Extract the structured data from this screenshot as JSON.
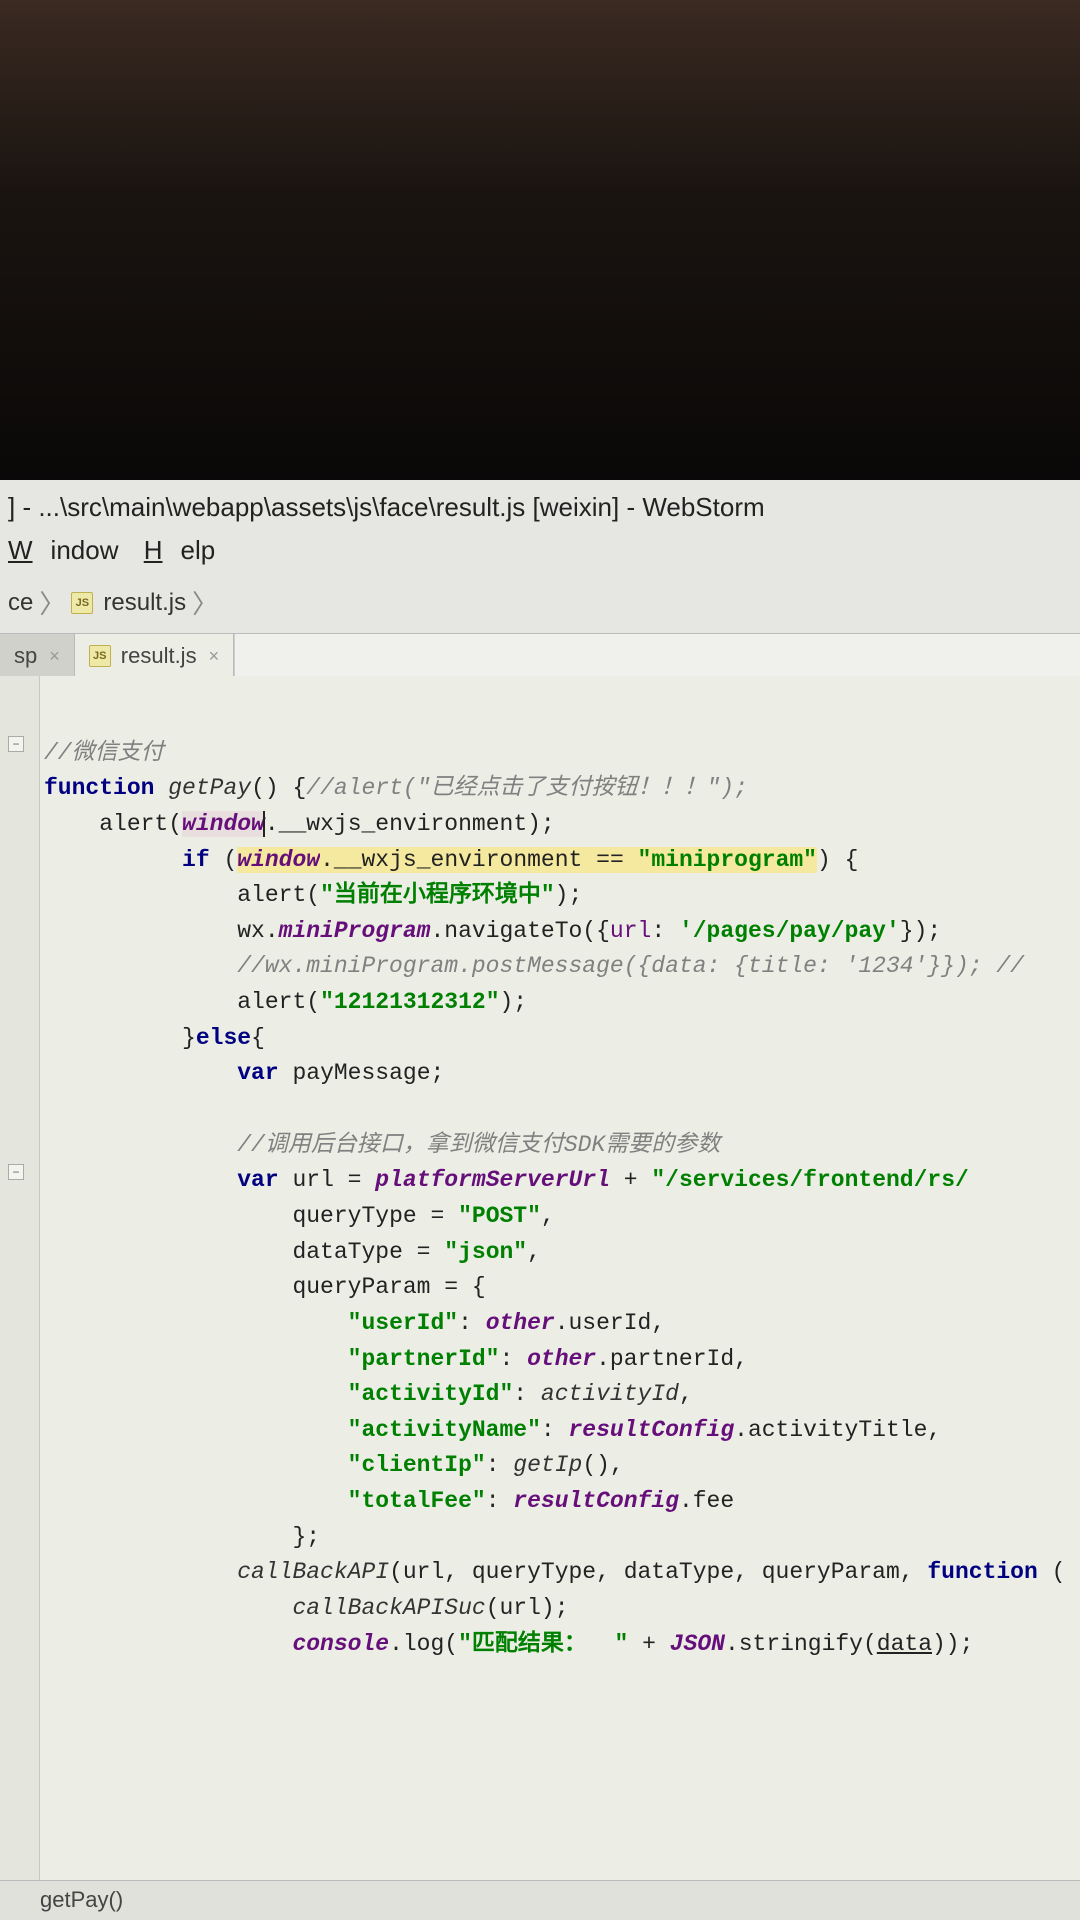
{
  "titlebar": "] - ...\\src\\main\\webapp\\assets\\js\\face\\result.js [weixin] - WebStorm",
  "menu": {
    "window": "Window",
    "help": "Help"
  },
  "breadcrumb": {
    "parent": "ce",
    "file": "result.js"
  },
  "tabs": {
    "left": "sp",
    "active": "result.js"
  },
  "code": {
    "c1": "//微信支付",
    "c2a": "function",
    "c2b": "getPay",
    "c2c": "() {",
    "c2d": "//alert(\"已经点击了支付按钮！！！\");",
    "c3a": "alert(",
    "c3b": "window",
    "c3c": ".__wxjs_environment);",
    "c4a": "if",
    "c4b": "(",
    "c4c": "window",
    "c4d": ".__wxjs_environment == ",
    "c4e": "\"miniprogram\"",
    "c4f": ") {",
    "c5a": "alert(",
    "c5b": "\"当前在小程序环境中\"",
    "c5c": ");",
    "c6a": "wx.",
    "c6b": "miniProgram",
    "c6c": ".navigateTo({",
    "c6d": "url",
    "c6e": ": ",
    "c6f": "'/pages/pay/pay'",
    "c6g": "});",
    "c7": "//wx.miniProgram.postMessage({data: {title: '1234'}}); //",
    "c8a": "alert(",
    "c8b": "\"12121312312\"",
    "c8c": ");",
    "c9a": "}",
    "c9b": "else",
    "c9c": "{",
    "c10a": "var",
    "c10b": "payMessage;",
    "c12": "//调用后台接口，拿到微信支付SDK需要的参数",
    "c13a": "var",
    "c13b": "url = ",
    "c13c": "platformServerUrl",
    "c13d": " + ",
    "c13e": "\"/services/frontend/rs/",
    "c14a": "queryType = ",
    "c14b": "\"POST\"",
    "c14c": ",",
    "c15a": "dataType = ",
    "c15b": "\"json\"",
    "c15c": ",",
    "c16": "queryParam = {",
    "c17a": "\"userId\"",
    "c17b": ": ",
    "c17c": "other",
    "c17d": ".userId,",
    "c18a": "\"partnerId\"",
    "c18b": ": ",
    "c18c": "other",
    "c18d": ".partnerId,",
    "c19a": "\"activityId\"",
    "c19b": ": ",
    "c19c": "activityId",
    "c19d": ",",
    "c20a": "\"activityName\"",
    "c20b": ": ",
    "c20c": "resultConfig",
    "c20d": ".activityTitle,",
    "c21a": "\"clientIp\"",
    "c21b": ": ",
    "c21c": "getIp",
    "c21d": "(),",
    "c22a": "\"totalFee\"",
    "c22b": ": ",
    "c22c": "resultConfig",
    "c22d": ".fee",
    "c23": "};",
    "c24a": "callBackAPI",
    "c24b": "(url, queryType, dataType, queryParam, ",
    "c24c": "function",
    "c24d": " (",
    "c25a": "callBackAPISuc",
    "c25b": "(url);",
    "c26a": "console",
    "c26b": ".log(",
    "c26c": "\"匹配结果：  \"",
    "c26d": " + ",
    "c26e": "JSON",
    "c26f": ".stringify(",
    "c26g": "data",
    "c26h": "));"
  },
  "status": "getPay()"
}
